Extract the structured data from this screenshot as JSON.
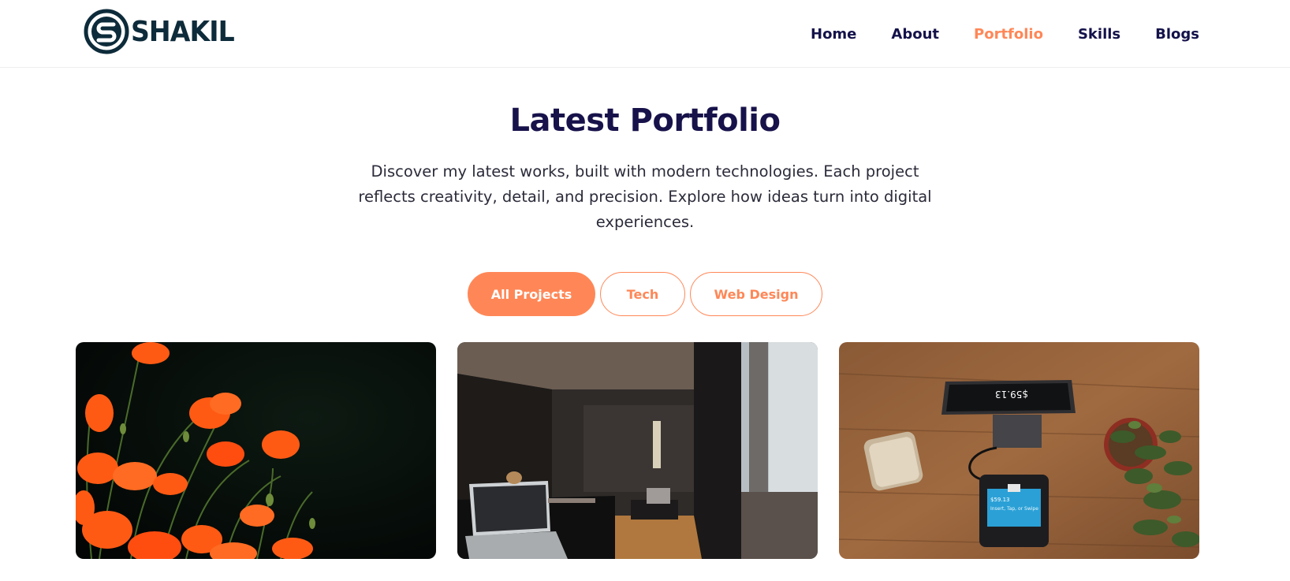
{
  "brand": {
    "name": "SHAKIL",
    "logo_letter": "S"
  },
  "nav": {
    "items": [
      {
        "label": "Home"
      },
      {
        "label": "About"
      },
      {
        "label": "Portfolio"
      },
      {
        "label": "Skills"
      },
      {
        "label": "Blogs"
      }
    ],
    "active": "Portfolio"
  },
  "section": {
    "title": "Latest Portfolio",
    "intro": "Discover my latest works, built with modern technologies. Each project reflects creativity, detail, and precision. Explore how ideas turn into digital experiences."
  },
  "filters": {
    "items": [
      {
        "label": "All Projects"
      },
      {
        "label": "Tech"
      },
      {
        "label": "Web Design"
      }
    ],
    "active": "All Projects"
  },
  "projects": [
    {
      "image": "orange-poppies-photo"
    },
    {
      "image": "dark-interior-laptop-photo"
    },
    {
      "image": "payment-terminal-desk-photo",
      "screen_amount": "$59.13",
      "screen_prompt": "Insert, Tap, or Swipe",
      "receipt_amount": "$59.13"
    }
  ],
  "colors": {
    "accent": "#ff8757",
    "heading": "#17124a",
    "nav_text": "#14124a",
    "logo": "#0d2b3a"
  }
}
